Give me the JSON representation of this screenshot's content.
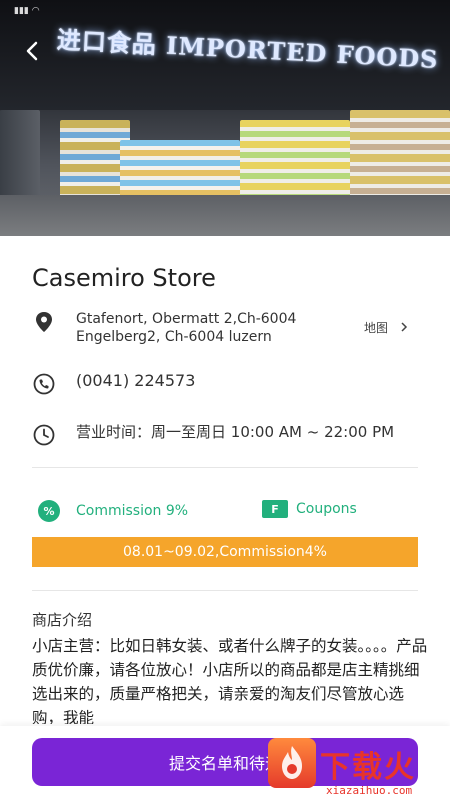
{
  "hero": {
    "sign_text": "进口食品 IMPORTED FOODS",
    "back_icon": "chevron-left-icon"
  },
  "store": {
    "name": "Casemiro Store",
    "address_line1": "Gtafenort, Obermatt 2,Ch-6004",
    "address_line2": "Engelberg2, Ch-6004 luzern",
    "map_label": "地图",
    "phone": "(0041) 224573",
    "hours": "营业时间：周一至周日 10:00 AM ~ 22:00 PM"
  },
  "tags": {
    "commission_label": "Commission 9%",
    "commission_badge": "%",
    "coupons_label": "Coupons",
    "coupons_badge": "F"
  },
  "promo": {
    "text": "08.01~09.02,Commission4%"
  },
  "intro": {
    "heading": "商店介绍",
    "body": "小店主营：比如日韩女装、或者什么牌子的女装。。。。产品质优价廉，请各位放心！小店所以的商品都是店主精挑细选出来的，质量严格把关，请亲爱的淘友们尽管放心选购，我能"
  },
  "bottom": {
    "submit_label": "提交名单和待遇"
  },
  "watermark": {
    "brand": "下载火",
    "url": "xiazaihuo.com"
  },
  "colors": {
    "accent_purple": "#7a25d6",
    "accent_green": "#22b07d",
    "promo_orange": "#f5a52b"
  }
}
